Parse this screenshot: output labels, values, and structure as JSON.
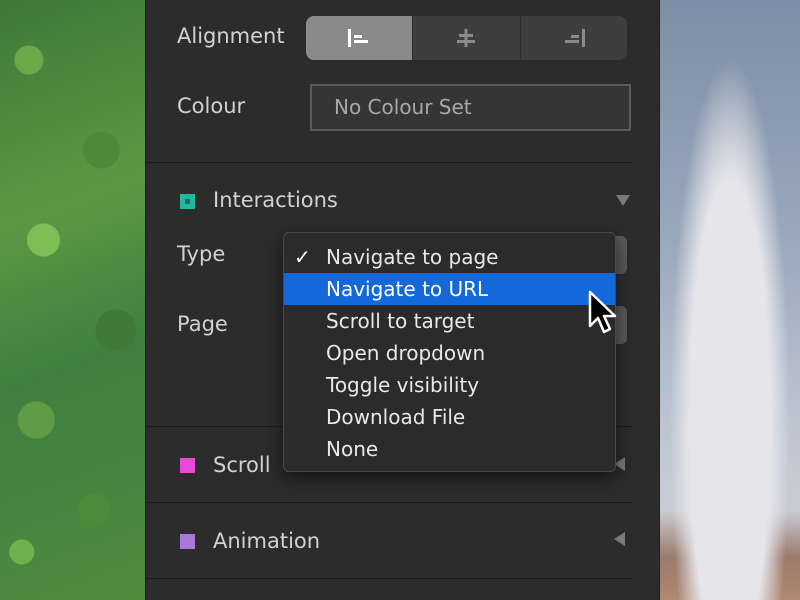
{
  "properties": {
    "alignment_label": "Alignment",
    "alignment_options": [
      {
        "icon": "align-left-icon",
        "glyph": "|="
      },
      {
        "icon": "align-center-icon",
        "glyph": "±"
      },
      {
        "icon": "align-right-icon",
        "glyph": "=|"
      }
    ],
    "alignment_selected": 0,
    "colour_label": "Colour",
    "colour_value": "No Colour Set"
  },
  "sections": {
    "interactions": {
      "title": "Interactions",
      "color": "#22b8a0",
      "expanded": true
    },
    "scroll": {
      "title": "Scroll",
      "color": "#e84ad8",
      "expanded": false
    },
    "animation": {
      "title": "Animation",
      "color": "#a978d8",
      "expanded": false
    }
  },
  "interactions_fields": {
    "type_label": "Type",
    "page_label": "Page"
  },
  "dropdown": {
    "items": [
      {
        "label": "Navigate to page",
        "checked": true,
        "highlighted": false
      },
      {
        "label": "Navigate to URL",
        "checked": false,
        "highlighted": true
      },
      {
        "label": "Scroll to target",
        "checked": false,
        "highlighted": false
      },
      {
        "label": "Open dropdown",
        "checked": false,
        "highlighted": false
      },
      {
        "label": "Toggle visibility",
        "checked": false,
        "highlighted": false
      },
      {
        "label": "Download File",
        "checked": false,
        "highlighted": false
      },
      {
        "label": "None",
        "checked": false,
        "highlighted": false
      }
    ],
    "check_glyph": "✓",
    "highlight_color": "#1568d9"
  }
}
